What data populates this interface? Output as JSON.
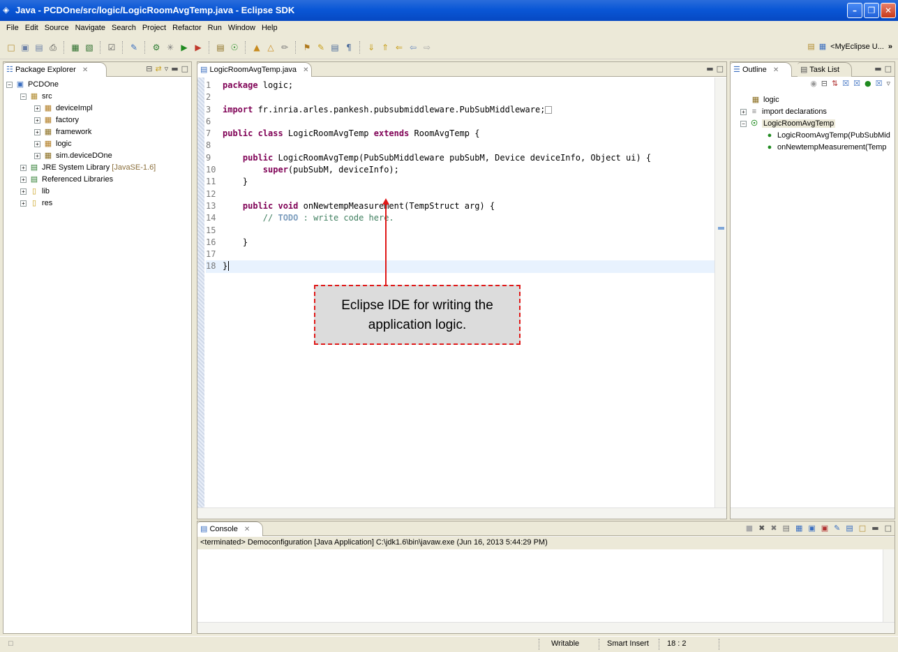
{
  "window": {
    "title": "Java - PCDOne/src/logic/LogicRoomAvgTemp.java - Eclipse SDK"
  },
  "menu": [
    "File",
    "Edit",
    "Source",
    "Navigate",
    "Search",
    "Project",
    "Refactor",
    "Run",
    "Window",
    "Help"
  ],
  "toolbar": {
    "perspective_label": "<MyEclipse U...",
    "overflow": "»"
  },
  "package_explorer": {
    "tab_label": "Package Explorer",
    "project": "PCDOne",
    "src": "src",
    "packages": [
      "deviceImpl",
      "factory",
      "framework",
      "logic",
      "sim.deviceDOne"
    ],
    "jre_label": "JRE System Library",
    "jre_version": "[JavaSE-1.6]",
    "referenced": "Referenced Libraries",
    "folders": [
      "lib",
      "res"
    ]
  },
  "editor": {
    "tab_label": "LogicRoomAvgTemp.java",
    "lines": {
      "l1_kw": "package",
      "l1_rest": " logic;",
      "l3_kw": "import",
      "l3_rest": " fr.inria.arles.pankesh.pubsubmiddleware.PubSubMiddleware;",
      "l7_kw1": "public class",
      "l7_mid": " LogicRoomAvgTemp ",
      "l7_kw2": "extends",
      "l7_rest": " RoomAvgTemp {",
      "l9_kw": "public",
      "l9_rest": " LogicRoomAvgTemp(PubSubMiddleware pubSubM, Device deviceInfo, Object ui) {",
      "l10_kw": "super",
      "l10_rest": "(pubSubM, deviceInfo);",
      "l11": "}",
      "l13_kw": "public void",
      "l13_rest": " onNewtempMeasurement(TempStruct arg) {",
      "l14_cm1": "// ",
      "l14_todo": "TODO",
      "l14_cm2": " : write code here.",
      "l16": "}",
      "l18": "}"
    },
    "line_numbers": [
      "1",
      "2",
      "3",
      "6",
      "7",
      "8",
      "9",
      "10",
      "11",
      "12",
      "13",
      "14",
      "15",
      "16",
      "17",
      "18"
    ]
  },
  "outline": {
    "tab_label": "Outline",
    "tab2_label": "Task List",
    "items": [
      "logic",
      "import declarations",
      "LogicRoomAvgTemp",
      "LogicRoomAvgTemp(PubSubMid",
      "onNewtempMeasurement(Temp"
    ]
  },
  "console": {
    "tab_label": "Console",
    "header": "<terminated> Democonfiguration [Java Application] C:\\jdk1.6\\bin\\javaw.exe (Jun 16, 2013 5:44:29 PM)"
  },
  "annotation": {
    "text": "Eclipse IDE for writing the application logic."
  },
  "status": {
    "writable": "Writable",
    "insert_mode": "Smart Insert",
    "position": "18 : 2"
  },
  "colors": {
    "keyword": "#7f0055",
    "comment": "#3f7f5f",
    "todo": "#7f9fbf",
    "annotation_border": "#e01818",
    "titlebar": "#0a57d6"
  }
}
